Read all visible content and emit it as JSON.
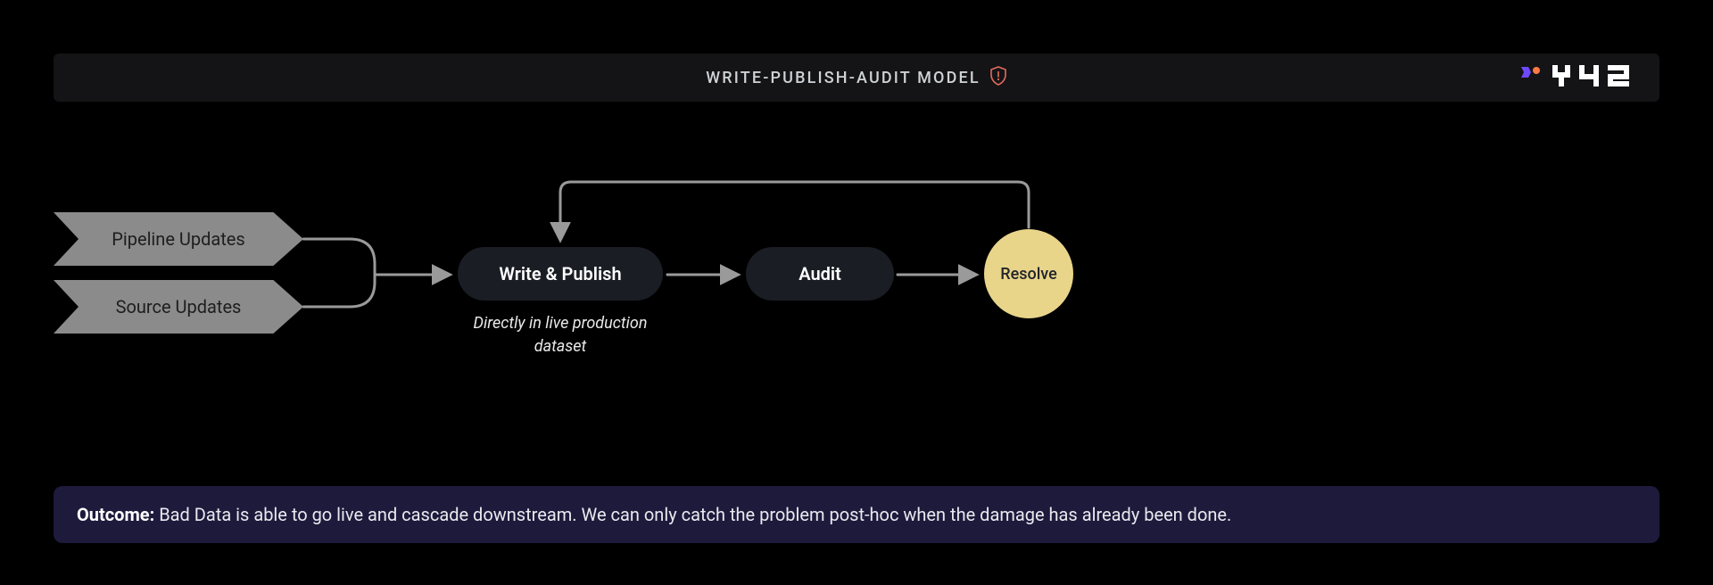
{
  "header": {
    "title": "WRITE-PUBLISH-AUDIT MODEL",
    "brand": "Y42",
    "icon": "warning-shield"
  },
  "inputs": [
    {
      "id": "pipeline",
      "label": "Pipeline Updates"
    },
    {
      "id": "source",
      "label": "Source Updates"
    }
  ],
  "nodes": {
    "write": {
      "label": "Write & Publish",
      "sub": "Directly in live production dataset"
    },
    "audit": {
      "label": "Audit"
    },
    "resolve": {
      "label": "Resolve"
    }
  },
  "edges": [
    {
      "from": "pipeline",
      "to": "write",
      "kind": "merge"
    },
    {
      "from": "source",
      "to": "write",
      "kind": "merge"
    },
    {
      "from": "write",
      "to": "audit",
      "kind": "arrow"
    },
    {
      "from": "audit",
      "to": "resolve",
      "kind": "arrow"
    },
    {
      "from": "resolve",
      "to": "write",
      "kind": "loop-back"
    }
  ],
  "outcome": {
    "label": "Outcome:",
    "text": "Bad Data is able to go live and cascade downstream. We can only catch the problem post-hoc when the damage has already been done."
  },
  "colors": {
    "bg": "#000000",
    "headerBg": "#141416",
    "chevron": "#8b8b8b",
    "pill": "#1a1d24",
    "circle": "#e9d58a",
    "outcomeBg": "#1e1a3c",
    "stroke": "#9a9a9a",
    "accentPurple": "#6d4aff",
    "accentOrange": "#ff7a45",
    "warn": "#e46a5e"
  }
}
